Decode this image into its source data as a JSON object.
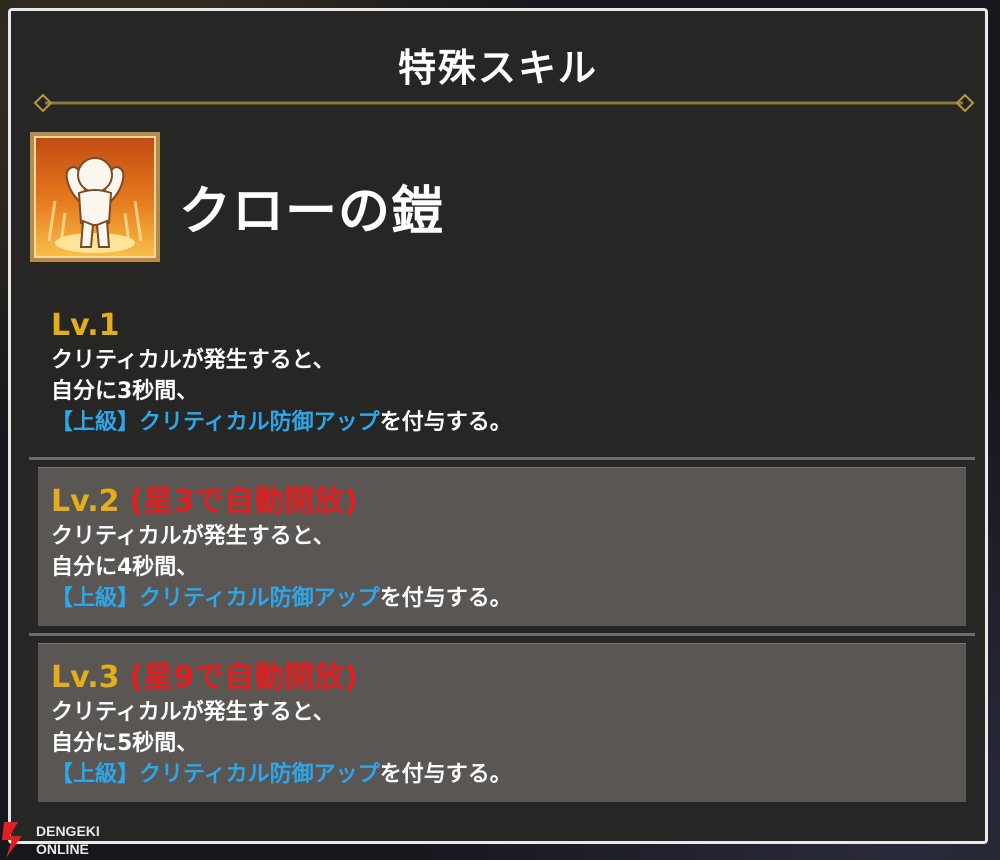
{
  "panel": {
    "title": "特殊スキル"
  },
  "skill": {
    "name": "クローの鎧",
    "icon": "muscle-figure-icon"
  },
  "levels": [
    {
      "label": "Lv.1",
      "unlock": "",
      "line1": "クリティカルが発生すると、",
      "line2": "自分に3秒間、",
      "keyword": "【上級】クリティカル防御アップ",
      "suffix": "を付与する。"
    },
    {
      "label": "Lv.2",
      "unlock": "(星3で自動開放)",
      "line1": "クリティカルが発生すると、",
      "line2": "自分に4秒間、",
      "keyword": "【上級】クリティカル防御アップ",
      "suffix": "を付与する。"
    },
    {
      "label": "Lv.3",
      "unlock": "(星9で自動開放)",
      "line1": "クリティカルが発生すると、",
      "line2": "自分に5秒間、",
      "keyword": "【上級】クリティカル防御アップ",
      "suffix": "を付与する。"
    }
  ],
  "watermark": {
    "line1": "DENGEKI",
    "line2": "ONLINE"
  },
  "colors": {
    "level_label": "#e4ae1b",
    "unlock_text": "#e02020",
    "keyword": "#2ea6ea",
    "locked_box": "#595653"
  }
}
